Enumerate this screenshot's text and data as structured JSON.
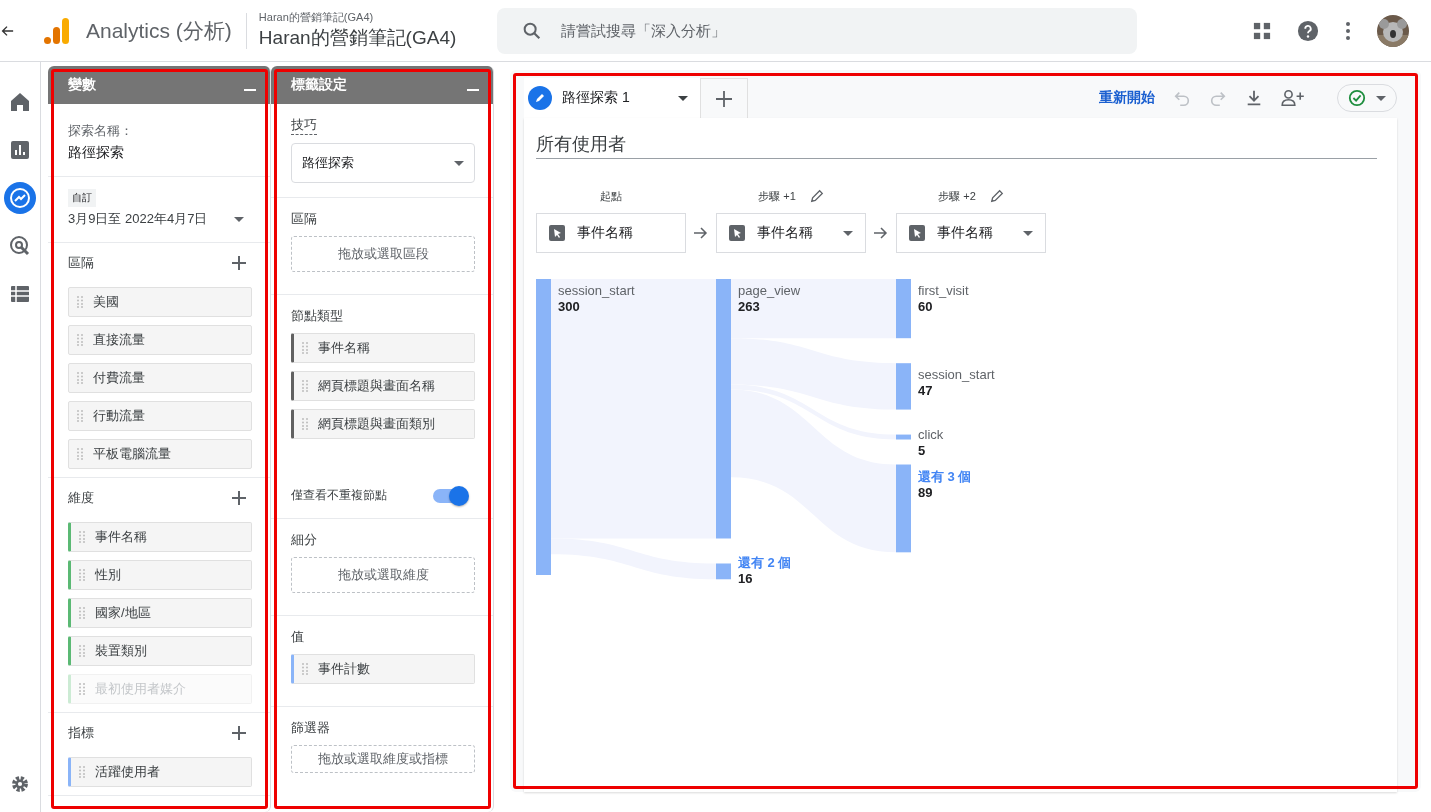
{
  "topbar": {
    "product": "Analytics (分析)",
    "account": "Haran的營銷筆記(GA4)",
    "property": "Haran的營銷筆記(GA4)",
    "search": {
      "placeholder": "請嘗試搜尋「深入分析」"
    }
  },
  "nav_rail": [
    {
      "kind": "home",
      "selected": false
    },
    {
      "kind": "reports",
      "selected": false
    },
    {
      "kind": "explore",
      "selected": true
    },
    {
      "kind": "advertising",
      "selected": false
    },
    {
      "kind": "configure",
      "selected": false
    }
  ],
  "variables_panel": {
    "title": "變數",
    "name_label": "探索名稱：",
    "name_value": "路徑探索",
    "date_tag": "自訂",
    "date_range": "3月9日至 2022年4月7日",
    "sections": [
      {
        "title": "區隔",
        "kind": "segment",
        "items": [
          {
            "label": "美國",
            "faded": false
          },
          {
            "label": "直接流量",
            "faded": false
          },
          {
            "label": "付費流量",
            "faded": false
          },
          {
            "label": "行動流量",
            "faded": false
          },
          {
            "label": "平板電腦流量",
            "faded": false
          }
        ]
      },
      {
        "title": "維度",
        "kind": "dimension",
        "items": [
          {
            "label": "事件名稱",
            "faded": false
          },
          {
            "label": "性別",
            "faded": false
          },
          {
            "label": "國家/地區",
            "faded": false
          },
          {
            "label": "裝置類別",
            "faded": false
          },
          {
            "label": "最初使用者媒介",
            "faded": true
          }
        ]
      },
      {
        "title": "指標",
        "kind": "metric",
        "items": [
          {
            "label": "活躍使用者",
            "faded": false
          }
        ]
      }
    ]
  },
  "settings_panel": {
    "title": "標籤設定",
    "technique_label": "技巧",
    "technique_value": "路徑探索",
    "segments_label": "區隔",
    "segments_drop": "拖放或選取區段",
    "node_type_label": "節點類型",
    "node_types": [
      "事件名稱",
      "網頁標題與畫面名稱",
      "網頁標題與畫面類別"
    ],
    "unique_nodes": {
      "label": "僅查看不重複節點",
      "on": true
    },
    "breakdown_label": "細分",
    "breakdown_drop": "拖放或選取維度",
    "values_label": "值",
    "values": [
      "事件計數"
    ],
    "filters_label": "篩選器",
    "filters_drop": "拖放或選取維度或指標"
  },
  "canvas": {
    "tabs": [
      {
        "label": "路徑探索 1",
        "selected": true
      }
    ],
    "reset": "重新開始",
    "segment_title": "所有使用者",
    "steps": [
      {
        "label": "起點",
        "editable": false,
        "field": "事件名稱",
        "dropdown": false
      },
      {
        "label": "步驟 +1",
        "editable": true,
        "field": "事件名稱",
        "dropdown": true
      },
      {
        "label": "步驟 +2",
        "editable": true,
        "field": "事件名稱",
        "dropdown": true
      }
    ],
    "columns": [
      [
        {
          "label": "session_start",
          "value": "300",
          "kind": "event"
        }
      ],
      [
        {
          "label": "page_view",
          "value": "263",
          "kind": "event"
        },
        {
          "label": "還有 2 個",
          "value": "16",
          "kind": "more"
        }
      ],
      [
        {
          "label": "first_visit",
          "value": "60",
          "kind": "event"
        },
        {
          "label": "session_start",
          "value": "47",
          "kind": "event"
        },
        {
          "label": "click",
          "value": "5",
          "kind": "event"
        },
        {
          "label": "還有 3 個",
          "value": "89",
          "kind": "more"
        }
      ]
    ]
  }
}
